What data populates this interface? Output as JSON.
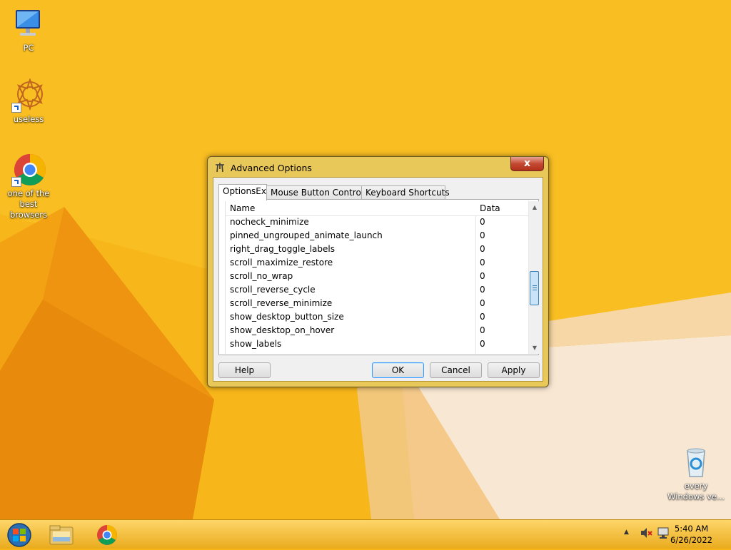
{
  "desktop": {
    "icons": [
      {
        "label": "PC",
        "icon": "computer-icon"
      },
      {
        "label": "useless",
        "icon": "mandala-icon"
      },
      {
        "label": "one of the best browsers",
        "icon": "chrome-icon"
      },
      {
        "label": "every Windows ve...",
        "icon": "recycle-bin-icon"
      }
    ]
  },
  "dialog": {
    "title": "Advanced Options",
    "close_label": "x",
    "tabs": [
      {
        "label": "OptionsEx",
        "active": true
      },
      {
        "label": "Mouse Button Control",
        "active": false
      },
      {
        "label": "Keyboard Shortcuts",
        "active": false
      }
    ],
    "columns": {
      "name": "Name",
      "data": "Data"
    },
    "rows": [
      {
        "name": "nocheck_minimize",
        "data": "0"
      },
      {
        "name": "pinned_ungrouped_animate_launch",
        "data": "0"
      },
      {
        "name": "right_drag_toggle_labels",
        "data": "0"
      },
      {
        "name": "scroll_maximize_restore",
        "data": "0"
      },
      {
        "name": "scroll_no_wrap",
        "data": "0"
      },
      {
        "name": "scroll_reverse_cycle",
        "data": "0"
      },
      {
        "name": "scroll_reverse_minimize",
        "data": "0"
      },
      {
        "name": "show_desktop_button_size",
        "data": "0"
      },
      {
        "name": "show_desktop_on_hover",
        "data": "0"
      },
      {
        "name": "show_labels",
        "data": "0"
      }
    ],
    "buttons": {
      "help": "Help",
      "ok": "OK",
      "cancel": "Cancel",
      "apply": "Apply"
    }
  },
  "taskbar": {
    "items": [
      "start-orb-icon",
      "file-explorer-icon",
      "chrome-icon"
    ],
    "tray": {
      "time": "5:40 AM",
      "date": "6/26/2022"
    }
  },
  "colors": {
    "wallpaper": "#f6b417",
    "dialog_frame": "#e9c85a",
    "close": "#c44a32",
    "accent": "#3399ff"
  }
}
